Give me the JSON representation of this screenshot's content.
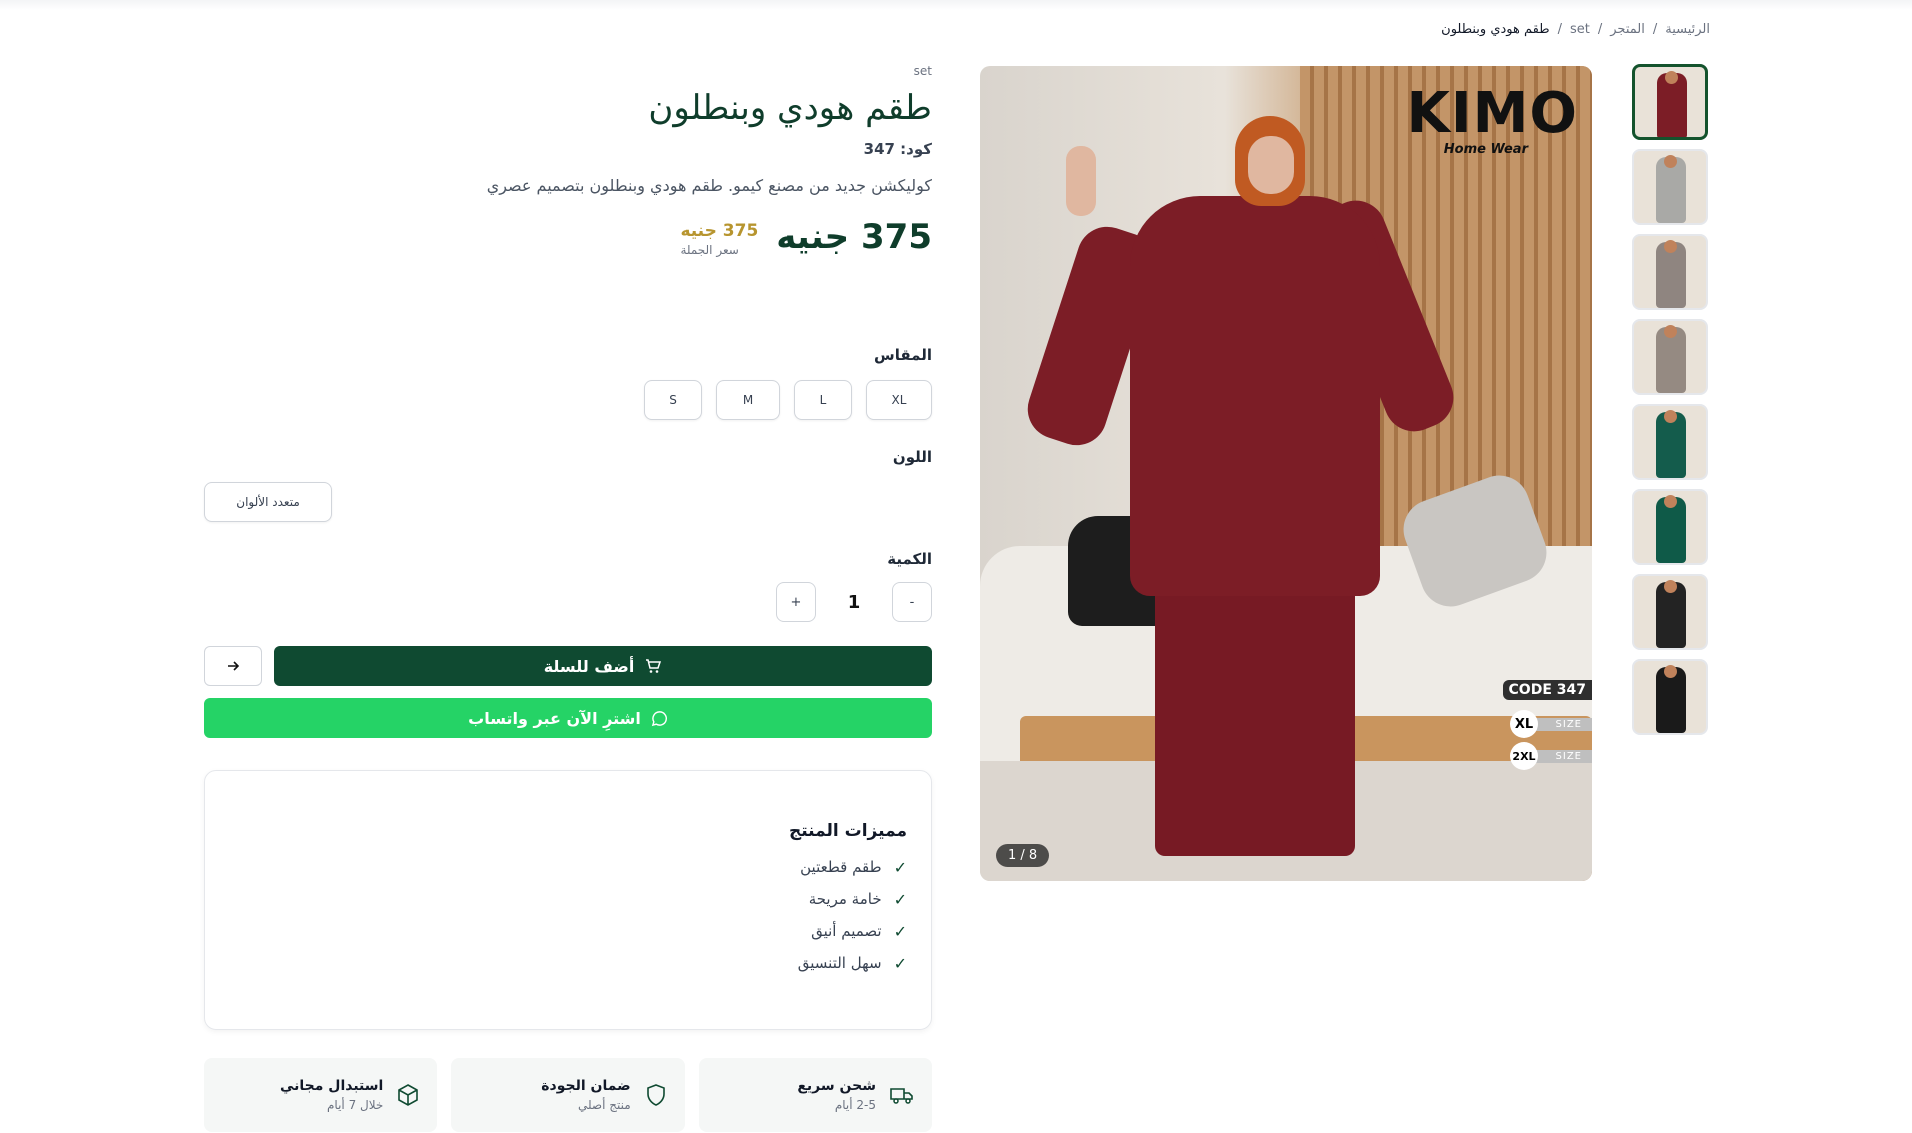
{
  "breadcrumb": {
    "home": "الرئيسية",
    "shop": "المتجر",
    "category": "set",
    "current": "طقم هودي وبنطلون",
    "sep": "/"
  },
  "gallery": {
    "counter": "1 / 8",
    "brand_logo": "KIMO",
    "brand_sub": "Home Wear",
    "code_badge": "CODE 347",
    "sizes": [
      "XL",
      "2XL"
    ],
    "size_word": "SIZE",
    "thumb_colors": [
      "#7c1d26",
      "#a9a9a6",
      "#8f8580",
      "#958a82",
      "#145c4c",
      "#0f5a48",
      "#232323",
      "#1a1a1a"
    ]
  },
  "product": {
    "category": "set",
    "title": "طقم هودي وبنطلون",
    "code": "كود: 347",
    "description": "كوليكشن جديد من مصنع كيمو. طقم هودي وبنطلون بتصميم عصري",
    "price": "375 جنيه",
    "wholesale_price": "375 جنيه",
    "wholesale_label": "سعر الجملة"
  },
  "size": {
    "label": "المقاس",
    "options": [
      "XL",
      "L",
      "M",
      "S"
    ]
  },
  "color": {
    "label": "اللون",
    "options": [
      "متعدد الألوان"
    ]
  },
  "quantity": {
    "label": "الكمية",
    "value": "1",
    "minus": "-",
    "plus": "+"
  },
  "actions": {
    "add_to_cart": "أضف للسلة",
    "whatsapp": "اشترِ الآن عبر واتساب"
  },
  "features": {
    "title": "مميزات المنتج",
    "items": [
      "طقم قطعتين",
      "خامة مريحة",
      "تصميم أنيق",
      "سهل التنسيق"
    ]
  },
  "perks": [
    {
      "title": "شحن سريع",
      "sub": "2-5 أيام",
      "icon": "truck-icon"
    },
    {
      "title": "ضمان الجودة",
      "sub": "منتج أصلي",
      "icon": "shield-icon"
    },
    {
      "title": "استبدال مجاني",
      "sub": "خلال 7 أيام",
      "icon": "box-icon"
    }
  ],
  "colors": {
    "primary": "#0f4a31",
    "whatsapp": "#25d366",
    "gold": "#b7952f"
  }
}
